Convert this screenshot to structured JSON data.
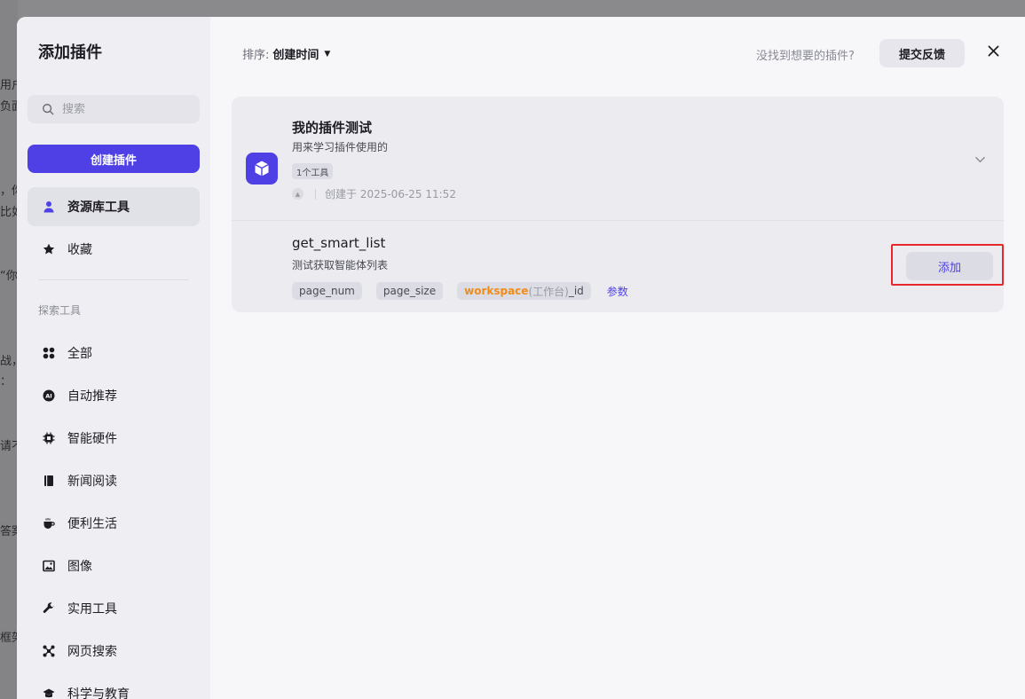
{
  "background": {
    "fragments": [
      "用户",
      "负面",
      "，你",
      "比如",
      "“你",
      "战，",
      "：",
      "请不",
      "答案",
      "框架"
    ]
  },
  "sidebar": {
    "title": "添加插件",
    "search_placeholder": "搜索",
    "create_button": "创建插件",
    "library_item": "资源库工具",
    "favorites_item": "收藏",
    "section_label": "探索工具",
    "categories": [
      {
        "label": "全部",
        "icon": "grid-icon"
      },
      {
        "label": "自动推荐",
        "icon": "ai-icon"
      },
      {
        "label": "智能硬件",
        "icon": "chip-icon"
      },
      {
        "label": "新闻阅读",
        "icon": "book-icon"
      },
      {
        "label": "便利生活",
        "icon": "cup-icon"
      },
      {
        "label": "图像",
        "icon": "image-icon"
      },
      {
        "label": "实用工具",
        "icon": "wrench-icon"
      },
      {
        "label": "网页搜索",
        "icon": "network-icon"
      },
      {
        "label": "科学与教育",
        "icon": "graduation-cap-icon"
      }
    ]
  },
  "toolbar": {
    "sort_label": "排序:",
    "sort_value": "创建时间",
    "not_found_text": "没找到想要的插件?",
    "feedback_button": "提交反馈"
  },
  "plugin": {
    "name": "我的插件测试",
    "description": "用来学习插件使用的",
    "tool_count": "1个工具",
    "created_text": "创建于 2025-06-25 11:52",
    "tool": {
      "name": "get_smart_list",
      "description": "测试获取智能体列表",
      "param1": "page_num",
      "param2": "page_size",
      "param3_highlight": "workspace",
      "param3_sub": "(工作台)",
      "param3_suffix": "_id",
      "params_link": "参数",
      "add_button": "添加"
    }
  },
  "colors": {
    "accent": "#4e40e5",
    "highlight_border": "#e8272a",
    "param_highlight": "#f28c18"
  }
}
